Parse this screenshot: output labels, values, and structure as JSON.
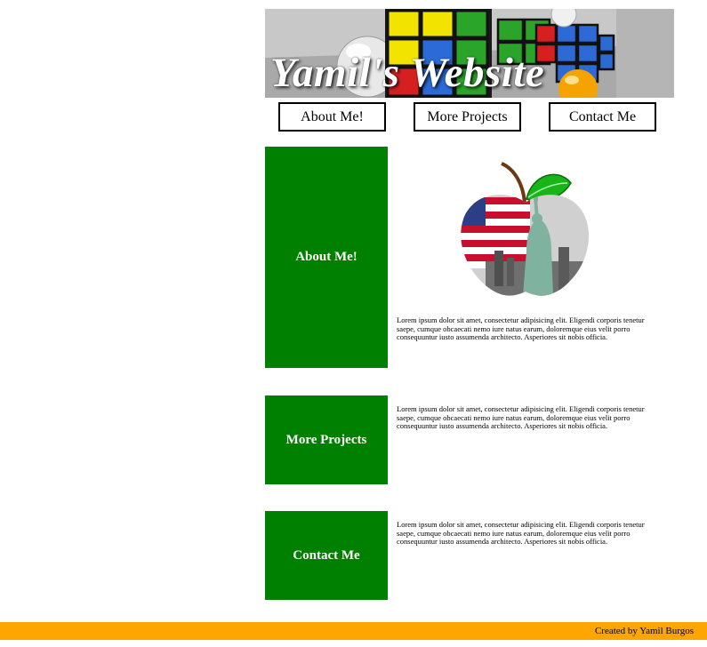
{
  "header": {
    "title": "Yamil's Website"
  },
  "nav": {
    "items": [
      {
        "label": "About Me!"
      },
      {
        "label": "More Projects"
      },
      {
        "label": "Contact Me"
      }
    ]
  },
  "sections": [
    {
      "heading": "About Me!",
      "text": "Lorem ipsum dolor sit amet, consectetur adipisicing elit. Eligendi corporis tenetur saepe, cumque obcaecati nemo iure natus earum, doloremque eius velit porro consequuntur iusto assumenda architecto. Asperiores sit nobis officia."
    },
    {
      "heading": "More Projects",
      "text": "Lorem ipsum dolor sit amet, consectetur adipisicing elit. Eligendi corporis tenetur saepe, cumque obcaecati nemo iure natus earum, doloremque eius velit porro consequuntur iusto assumenda architecto. Asperiores sit nobis officia."
    },
    {
      "heading": "Contact Me",
      "text": "Lorem ipsum dolor sit amet, consectetur adipisicing elit. Eligendi corporis tenetur saepe, cumque obcaecati nemo iure natus earum, doloremque eius velit porro consequuntur iusto assumenda architecto. Asperiores sit nobis officia."
    }
  ],
  "footer": {
    "text": "Created by Yamil Burgos"
  },
  "colors": {
    "tile": "#008000",
    "footer": "#ffa500"
  },
  "icons": {
    "banner": "rubiks-cube-banner-image",
    "about": "big-apple-liberty-image"
  }
}
